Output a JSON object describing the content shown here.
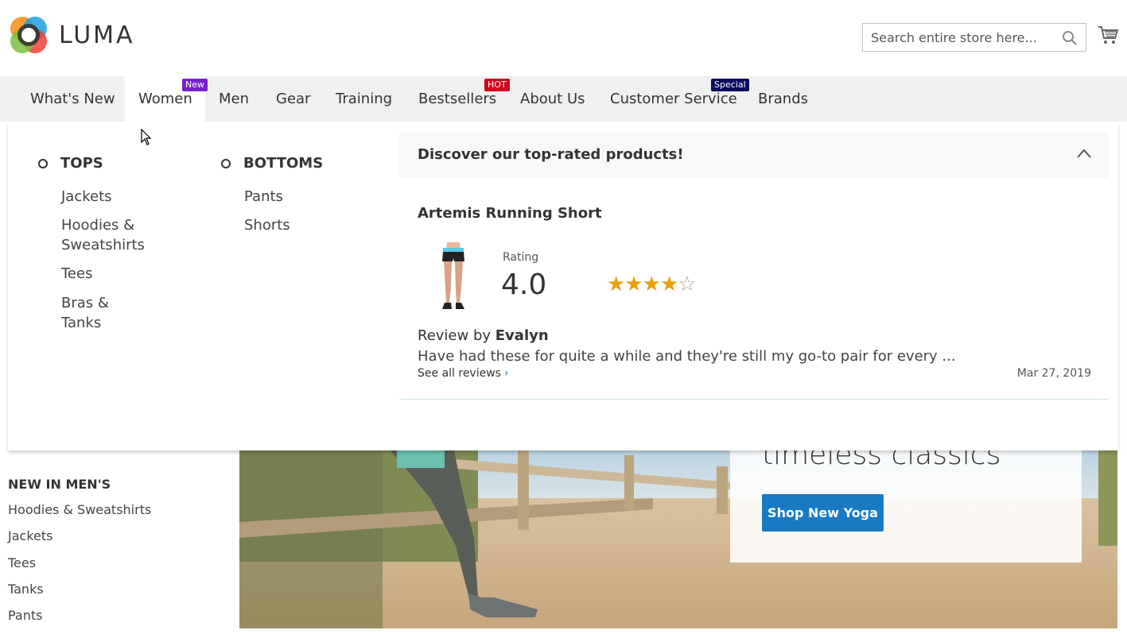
{
  "brand": {
    "name": "LUMA"
  },
  "search": {
    "placeholder": "Search entire store here..."
  },
  "nav": {
    "items": [
      {
        "label": "What's New"
      },
      {
        "label": "Women",
        "badge": "New",
        "badge_color": "#7a1fcf"
      },
      {
        "label": "Men"
      },
      {
        "label": "Gear"
      },
      {
        "label": "Training"
      },
      {
        "label": "Bestsellers",
        "badge": "HOT",
        "badge_color": "#d0021b"
      },
      {
        "label": "About Us"
      },
      {
        "label": "Customer Service",
        "badge": "Special",
        "badge_color": "#0a0a5e"
      },
      {
        "label": "Brands"
      }
    ]
  },
  "megamenu": {
    "tops": {
      "heading": "TOPS",
      "links": [
        "Jackets",
        "Hoodies & Sweatshirts",
        "Tees",
        "Bras & Tanks"
      ]
    },
    "bottoms": {
      "heading": "BOTTOMS",
      "links": [
        "Pants",
        "Shorts"
      ]
    },
    "promo": {
      "title": "Discover our top-rated products!",
      "product_name": "Artemis Running Short",
      "rating_label": "Rating",
      "rating_value": "4.0",
      "stars_filled": 4,
      "stars_total": 5,
      "review_by_prefix": "Review by",
      "reviewer": "Evalyn",
      "review_text": "Have had these for quite a while and they're still my go-to pair for every ...",
      "see_all": "See all reviews",
      "date": "Mar 27, 2019"
    }
  },
  "sidebar": {
    "heading": "NEW IN MEN'S",
    "links": [
      "Hoodies & Sweatshirts",
      "Jackets",
      "Tees",
      "Tanks",
      "Pants"
    ]
  },
  "hero": {
    "text": "timeless classics",
    "button": "Shop New Yoga"
  },
  "colors": {
    "accent": "#1979c3",
    "star": "#e89f0d",
    "nav_bg": "#f0f0f0"
  }
}
